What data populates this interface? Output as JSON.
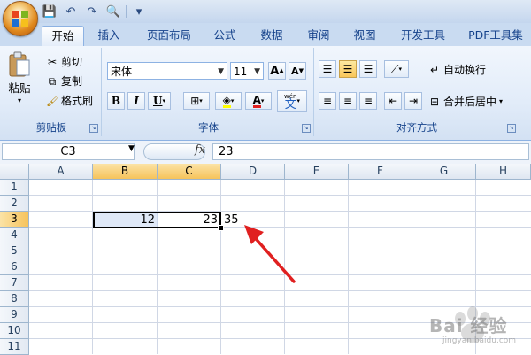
{
  "qat": {
    "save": "💾",
    "undo": "↶",
    "redo": "↷",
    "preview": "🔍",
    "customize": "▾"
  },
  "tabs": [
    "开始",
    "插入",
    "页面布局",
    "公式",
    "数据",
    "审阅",
    "视图",
    "开发工具",
    "PDF工具集"
  ],
  "clipboard": {
    "paste": "粘贴",
    "cut": "剪切",
    "copy": "复制",
    "format_painter": "格式刷",
    "label": "剪贴板"
  },
  "font": {
    "name": "宋体",
    "size": "11",
    "grow": "A",
    "shrink": "A",
    "bold": "B",
    "italic": "I",
    "underline": "U",
    "phonetic": "wén",
    "label": "字体"
  },
  "alignment": {
    "wrap": "自动换行",
    "merge": "合并后居中",
    "label": "对齐方式"
  },
  "formula_bar": {
    "name_box": "C3",
    "fx": "fx",
    "value": "23"
  },
  "columns": [
    "A",
    "B",
    "C",
    "D",
    "E",
    "F",
    "G",
    "H"
  ],
  "rows": [
    "1",
    "2",
    "3",
    "4",
    "5",
    "6",
    "7",
    "8",
    "9",
    "10",
    "11"
  ],
  "cells": {
    "B3": "12",
    "C3": "23",
    "D3": "35"
  },
  "watermark": {
    "text": "Bai 经验",
    "url": "jingyan.baidu.com"
  },
  "colors": {
    "accent": "#15428b",
    "selected_header": "#f6c35b",
    "arrow": "#e02020"
  }
}
